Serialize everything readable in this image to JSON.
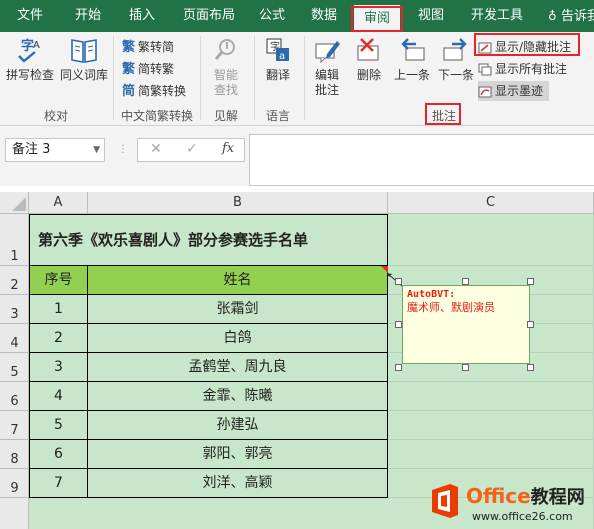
{
  "ribbon_tabs": [
    "文件",
    "开始",
    "插入",
    "页面布局",
    "公式",
    "数据",
    "审阅",
    "视图",
    "开发工具",
    "告诉我"
  ],
  "active_tab": "审阅",
  "groups": {
    "proofing": {
      "label": "校对",
      "spell": "拼写检查",
      "thesaurus": "同义词库"
    },
    "chinese": {
      "label": "中文简繁转换",
      "t2s": "繁转简",
      "s2t": "简转繁",
      "convert": "简繁转换"
    },
    "insights": {
      "label": "见解",
      "smart_lookup_1": "智能",
      "smart_lookup_2": "查找"
    },
    "language": {
      "label": "语言",
      "translate": "翻译"
    },
    "comments": {
      "label": "批注",
      "edit_1": "编辑",
      "edit_2": "批注",
      "delete": "删除",
      "prev": "上一条",
      "next": "下一条",
      "show_hide": "显示/隐藏批注",
      "show_all": "显示所有批注",
      "show_ink": "显示墨迹"
    }
  },
  "formula_bar": {
    "name_box": "备注 3",
    "fx": "fx",
    "formula": ""
  },
  "columns": [
    "A",
    "B",
    "C"
  ],
  "rows": [
    "1",
    "2",
    "3",
    "4",
    "5",
    "6",
    "7",
    "8",
    "9"
  ],
  "table": {
    "title": "第六季《欢乐喜剧人》部分参赛选手名单",
    "headers": [
      "序号",
      "姓名"
    ],
    "rows": [
      [
        "1",
        "张霜剑"
      ],
      [
        "2",
        "白鸽"
      ],
      [
        "3",
        "孟鹤堂、周九良"
      ],
      [
        "4",
        "金霏、陈曦"
      ],
      [
        "5",
        "孙建弘"
      ],
      [
        "6",
        "郭阳、郭亮"
      ],
      [
        "7",
        "刘洋、高颖"
      ]
    ]
  },
  "comment": {
    "author": "AutoBVT:",
    "text": "魔术师、默剧演员"
  },
  "watermark": {
    "brand_1": "Office",
    "brand_2": "教程网",
    "url": "www.office26.com"
  },
  "colors": {
    "excel_green": "#217346",
    "highlight": "#e8232d",
    "header_green": "#92d050",
    "comment_bg": "#ffffe1"
  }
}
